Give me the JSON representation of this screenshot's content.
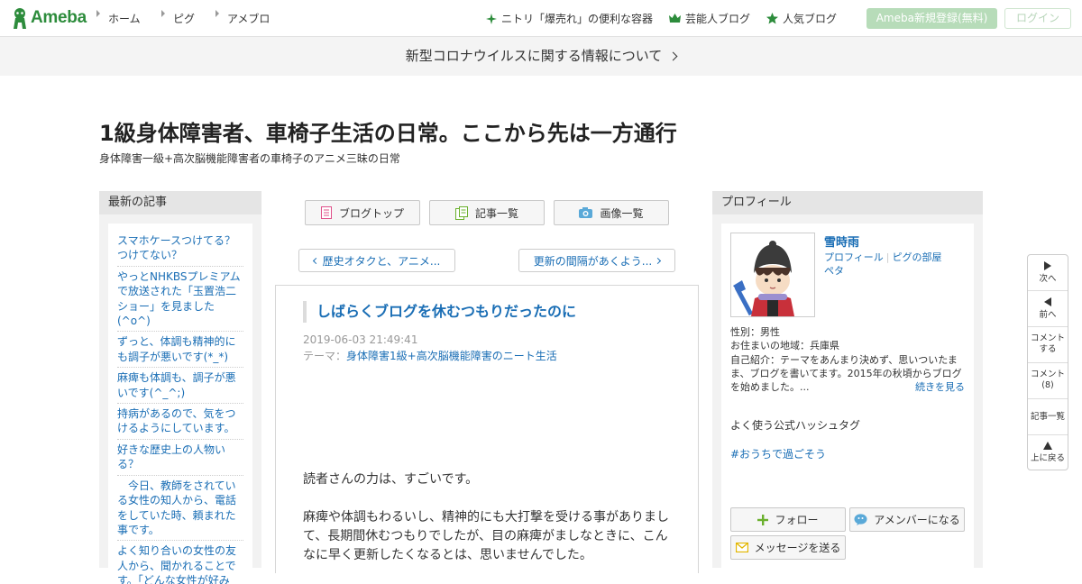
{
  "header": {
    "logo_text": "Ameba",
    "nav": [
      "ホーム",
      "ピグ",
      "アメブロ"
    ],
    "links": [
      {
        "label": "ニトリ「爆売れ」の便利な容器",
        "icon": "sparkle-icon"
      },
      {
        "label": "芸能人ブログ",
        "icon": "crown-icon"
      },
      {
        "label": "人気ブログ",
        "icon": "star-icon"
      }
    ],
    "register_label": "Ameba新規登録(無料)",
    "login_label": "ログイン"
  },
  "notice": {
    "text": "新型コロナウイルスに関する情報について"
  },
  "blog": {
    "title": "1級身体障害者、車椅子生活の日常。ここから先は一方通行",
    "description": "身体障害一級+高次脳機能障害者の車椅子のアニメ三昧の日常"
  },
  "left_sidebar": {
    "heading": "最新の記事",
    "articles": [
      "スマホケースつけてる？つけてない？",
      "やっとNHKBSプレミアムで放送された「玉置浩二ショー」を見ました(^o^)",
      "ずっと、体調も精神的にも調子が悪いです(*_*)",
      "麻痺も体調も、調子が悪いです(^_^;)",
      "持病があるので、気をつけるようにしています。",
      "好きな歴史上の人物いる？",
      "　今日、教師をされている女性の知人から、電話をしていた時、頼まれた事です。",
      "よく知り合いの女性の友人から、聞かれることです。「どんな女性が好み"
    ]
  },
  "center": {
    "buttons": [
      {
        "label": "ブログトップ",
        "icon": "blog-top-icon"
      },
      {
        "label": "記事一覧",
        "icon": "article-list-icon"
      },
      {
        "label": "画像一覧",
        "icon": "camera-icon"
      }
    ],
    "prev_label": "歴史オタクと、アニメ...",
    "next_label": "更新の間隔があくよう..."
  },
  "article": {
    "title": "しばらくブログを休むつもりだったのに",
    "date": "2019-06-03 21:49:41",
    "theme_prefix": "テーマ：",
    "theme": "身体障害1級+高次脳機能障害のニート生活",
    "paragraphs": [
      "読者さんの力は、すごいです。",
      "麻痺や体調もわるいし、精神的にも大打撃を受ける事がありまして、長期間休むつもりでしたが、目の麻痺がましなときに、こんなに早く更新したくなるとは、思いませんでした。"
    ]
  },
  "profile": {
    "heading": "プロフィール",
    "name": "雪時雨",
    "link_profile": "プロフィール",
    "link_pig": "ピグの部屋",
    "link_peta": "ペタ",
    "gender": "性別：男性",
    "location": "お住まいの地域：兵庫県",
    "intro": "自己紹介：テーマをあんまり決めず、思いついたまま、ブログを書いてます。2015年の秋頃からブログを始めました。...",
    "more_label": "続きを見る",
    "hashtag_heading": "よく使う公式ハッシュタグ",
    "hashtag": "#おうちで過ごそう",
    "follow_label": "フォロー",
    "amember_label": "アメンバーになる",
    "message_label": "メッセージを送る"
  },
  "float_nav": {
    "next": "次へ",
    "prev": "前へ",
    "comment_line1": "コメント",
    "comment_line2": "する",
    "comments_line1": "コメント",
    "comments_count": "(8)",
    "article_list": "記事一覧",
    "top": "上に戻る"
  },
  "colors": {
    "brand": "#2d8c3c",
    "link": "#1a6eb5",
    "register_bg": "#b7dcb9"
  }
}
